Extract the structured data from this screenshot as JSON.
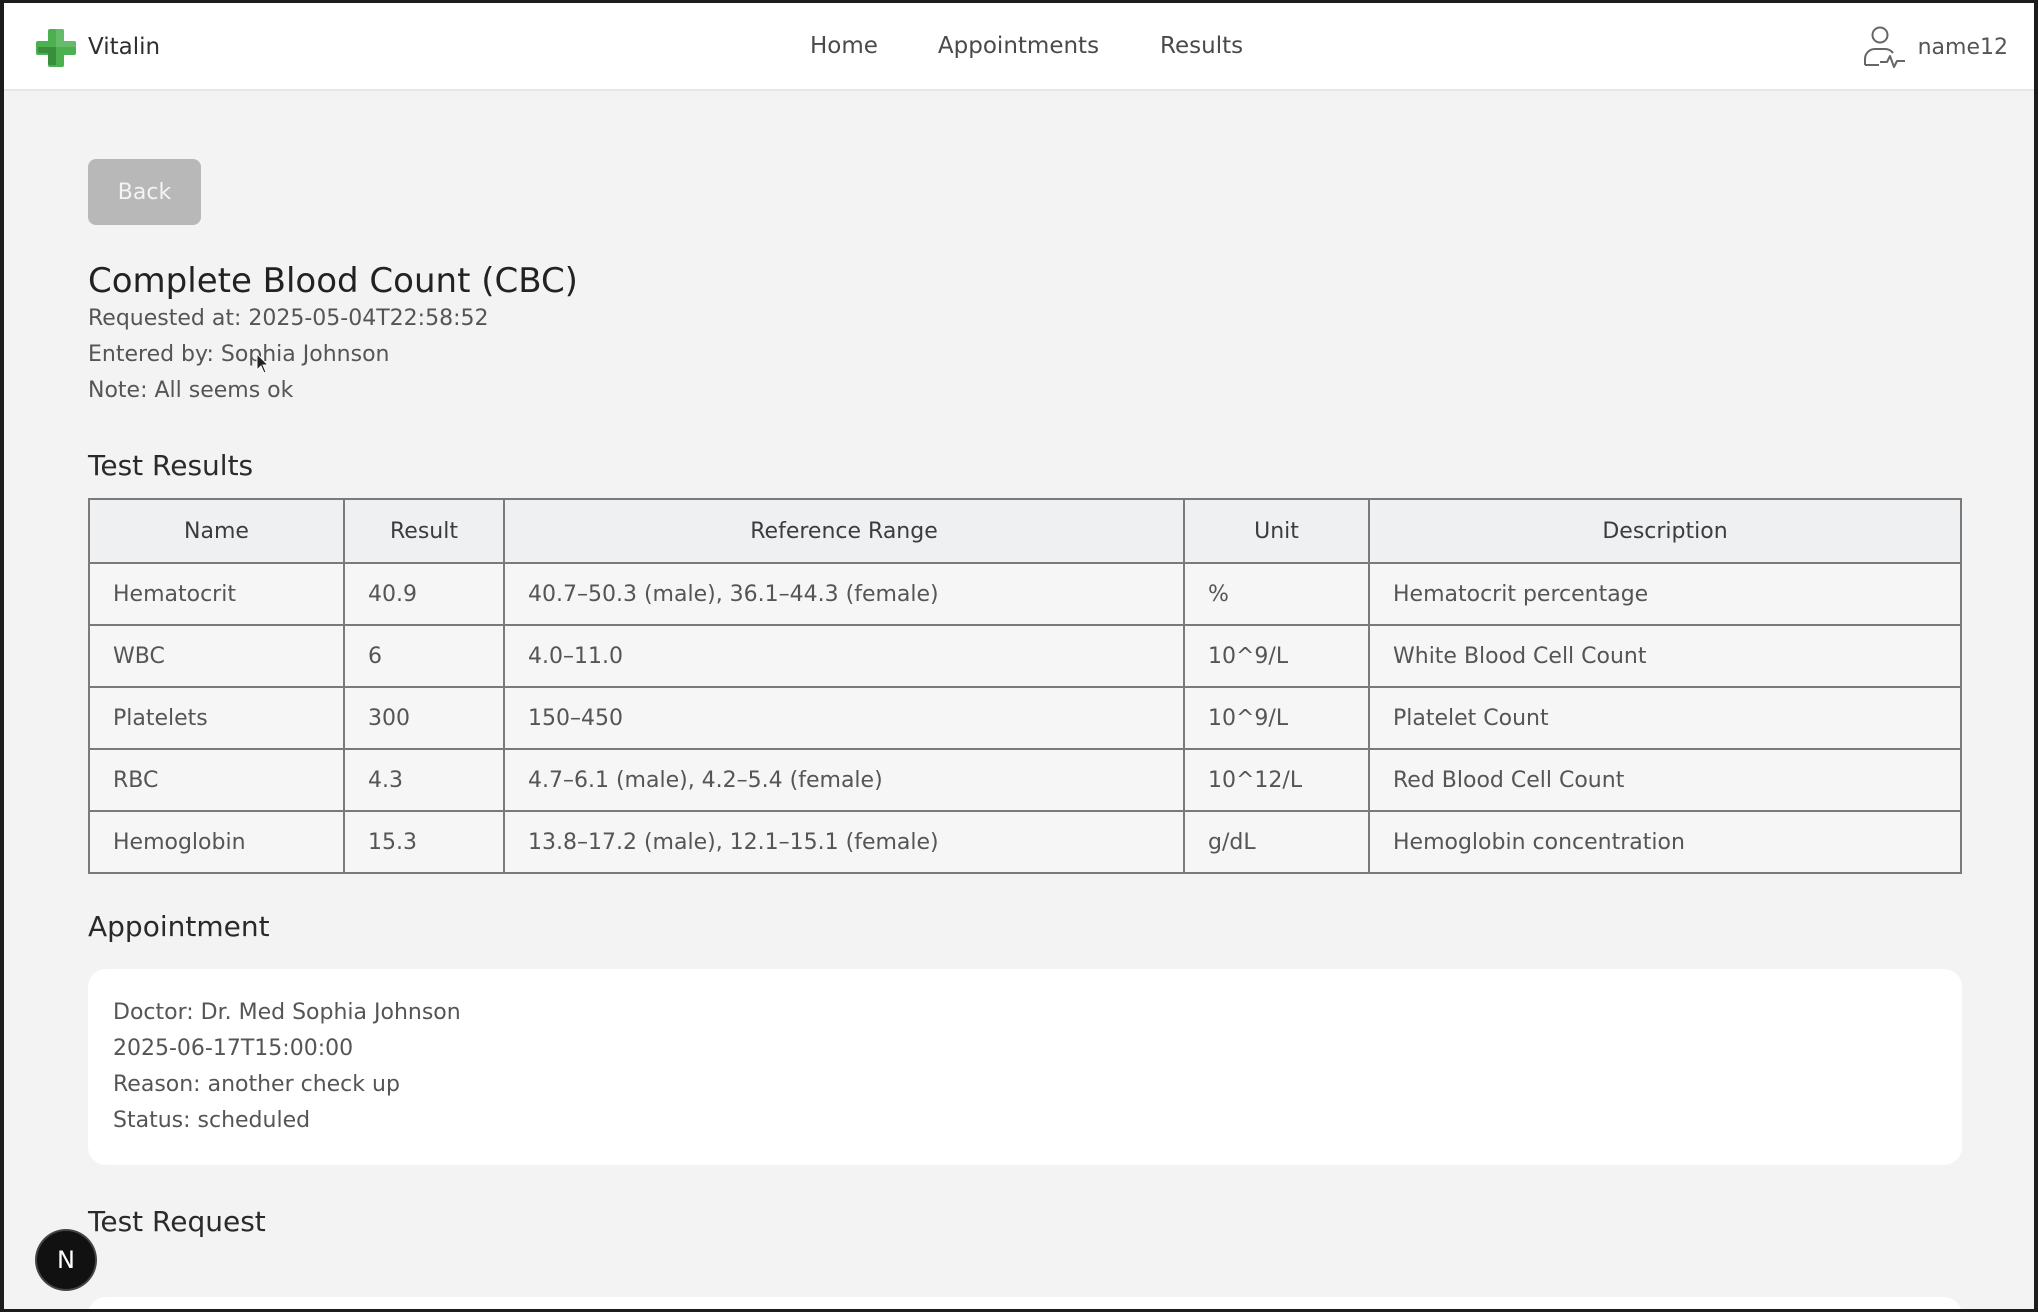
{
  "header": {
    "brand_name": "Vitalin",
    "nav": {
      "home": "Home",
      "appointments": "Appointments",
      "results": "Results"
    },
    "username": "name12",
    "brand_color": "#4caf50"
  },
  "page": {
    "back_label": "Back",
    "title": "Complete Blood Count (CBC)",
    "requested_at": "Requested at: 2025-05-04T22:58:52",
    "entered_by": "Entered by: Sophia Johnson",
    "note": "Note: All seems ok"
  },
  "results": {
    "title": "Test Results",
    "columns": {
      "name": "Name",
      "result": "Result",
      "range": "Reference Range",
      "unit": "Unit",
      "description": "Description"
    },
    "rows": [
      {
        "name": "Hematocrit",
        "result": "40.9",
        "range": "40.7–50.3 (male), 36.1–44.3 (female)",
        "unit": "%",
        "description": "Hematocrit percentage"
      },
      {
        "name": "WBC",
        "result": "6",
        "range": "4.0–11.0",
        "unit": "10^9/L",
        "description": "White Blood Cell Count"
      },
      {
        "name": "Platelets",
        "result": "300",
        "range": "150–450",
        "unit": "10^9/L",
        "description": "Platelet Count"
      },
      {
        "name": "RBC",
        "result": "4.3",
        "range": "4.7–6.1 (male), 4.2–5.4 (female)",
        "unit": "10^12/L",
        "description": "Red Blood Cell Count"
      },
      {
        "name": "Hemoglobin",
        "result": "15.3",
        "range": "13.8–17.2 (male), 12.1–15.1 (female)",
        "unit": "g/dL",
        "description": "Hemoglobin concentration"
      }
    ]
  },
  "appointment": {
    "title": "Appointment",
    "doctor": "Doctor: Dr. Med Sophia Johnson",
    "datetime": "2025-06-17T15:00:00",
    "reason": "Reason: another check up",
    "status": "Status: scheduled"
  },
  "test_request": {
    "title": "Test Request"
  },
  "badge": {
    "letter": "N"
  }
}
